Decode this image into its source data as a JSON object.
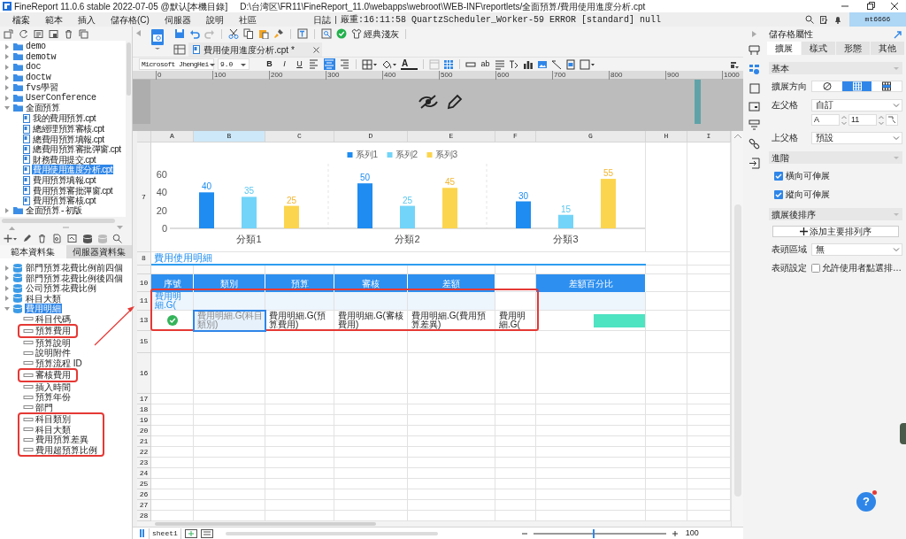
{
  "window": {
    "app_title": "FineReport 11.0.6 stable 2022-07-05 @默认[本機目錄]",
    "path": "D:\\台湾区\\FR11\\FineReport_11.0\\webapps\\webroot\\WEB-INF\\reportlets/全面預算/費用使用進度分析.cpt"
  },
  "menu": [
    "檔案",
    "範本",
    "插入",
    "儲存格(C)",
    "伺服器",
    "說明",
    "社區"
  ],
  "log": {
    "label": "日誌",
    "message": "嚴重:16:11:58 QuartzScheduler_Worker-59 ERROR [standard] null"
  },
  "user": "mt6666",
  "file_tree": [
    {
      "label": "demo",
      "kind": "folder",
      "expanded": false
    },
    {
      "label": "demotw",
      "kind": "folder",
      "expanded": false
    },
    {
      "label": "doc",
      "kind": "folder",
      "expanded": false
    },
    {
      "label": "doctw",
      "kind": "folder",
      "expanded": false
    },
    {
      "label": "fvs學習",
      "kind": "folder",
      "expanded": false
    },
    {
      "label": "UserConference",
      "kind": "folder",
      "expanded": false
    },
    {
      "label": "全面預算",
      "kind": "folder",
      "expanded": true,
      "children": [
        {
          "label": "我的費用預算.cpt",
          "kind": "file",
          "selected": false
        },
        {
          "label": "總經理預算審核.cpt",
          "kind": "file",
          "selected": false
        },
        {
          "label": "總費用預算填報.cpt",
          "kind": "file",
          "selected": false
        },
        {
          "label": "總費用預算審批彈窗.cpt",
          "kind": "file",
          "selected": false
        },
        {
          "label": "財務費用提交.cpt",
          "kind": "file",
          "selected": false
        },
        {
          "label": "費用使用進度分析.cpt",
          "kind": "file",
          "selected": true
        },
        {
          "label": "費用預算填報.cpt",
          "kind": "file",
          "selected": false
        },
        {
          "label": "費用預算審批彈窗.cpt",
          "kind": "file",
          "selected": false
        },
        {
          "label": "費用預算審核.cpt",
          "kind": "file",
          "selected": false
        }
      ]
    },
    {
      "label": "全面預算-初版",
      "kind": "folder",
      "expanded": false
    }
  ],
  "dataset_tabs": [
    {
      "label": "範本資料集",
      "selected": true
    },
    {
      "label": "伺服器資料集",
      "selected": false
    }
  ],
  "datasets": [
    {
      "label": "部門預算花費比例前四個",
      "expanded": false,
      "selected": false
    },
    {
      "label": "部門預算花費比例後四個",
      "expanded": false,
      "selected": false
    },
    {
      "label": "公司預算花費比例",
      "expanded": false,
      "selected": false
    },
    {
      "label": "科目大類",
      "expanded": false,
      "selected": false
    },
    {
      "label": "費用明細",
      "expanded": true,
      "selected": true,
      "children": [
        {
          "label": "科目代碼",
          "highlighted": false
        },
        {
          "label": "預算費用",
          "highlighted": true
        },
        {
          "label": "預算說明",
          "highlighted": false
        },
        {
          "label": "說明附件",
          "highlighted": false
        },
        {
          "label": "預算流程 ID",
          "highlighted": false
        },
        {
          "label": "審核費用",
          "highlighted": true
        },
        {
          "label": "插入時間",
          "highlighted": false
        },
        {
          "label": "預算年份",
          "highlighted": false
        },
        {
          "label": "部門",
          "highlighted": false
        },
        {
          "label": "科目類別",
          "highlighted": true
        },
        {
          "label": "科目大類",
          "highlighted": true
        },
        {
          "label": "費用預算差異",
          "highlighted": true
        },
        {
          "label": "費用超預算比例",
          "highlighted": true
        }
      ]
    }
  ],
  "toolbar": {
    "theme_label": "經典淺灰"
  },
  "template_tab": {
    "label": "費用使用進度分析.cpt *"
  },
  "format": {
    "font": "Microsoft JhengHei",
    "size": "9.0",
    "style_buttons": [
      "B",
      "I",
      "U"
    ],
    "font_color": "A",
    "text_tool": "ab"
  },
  "ruler": [
    "0",
    "100",
    "200",
    "300",
    "400",
    "500",
    "600",
    "700",
    "800",
    "900",
    "1000"
  ],
  "sheet": {
    "columns": [
      {
        "label": "A",
        "selected": false
      },
      {
        "label": "B",
        "selected": true
      },
      {
        "label": "C",
        "selected": false
      },
      {
        "label": "D",
        "selected": false
      },
      {
        "label": "E",
        "selected": false
      },
      {
        "label": "F",
        "selected": false
      },
      {
        "label": "G",
        "selected": false
      },
      {
        "label": "H",
        "selected": false
      },
      {
        "label": "I",
        "selected": false
      }
    ],
    "rows": [
      {
        "number": "7",
        "kind": "chart",
        "chart_data": {
          "type": "bar",
          "categories": [
            "分類1",
            "分類2",
            "分類3"
          ],
          "series": [
            {
              "name": "系列1",
              "color": "#1e8cf0",
              "values": [
                40,
                50,
                30
              ]
            },
            {
              "name": "系列2",
              "color": "#72d4f8",
              "values": [
                35,
                25,
                15
              ]
            },
            {
              "name": "系列3",
              "color": "#fcd54e",
              "values": [
                25,
                45,
                55
              ]
            }
          ],
          "yticks": [
            0,
            20,
            40,
            60
          ],
          "ylim": [
            0,
            60
          ],
          "legend": "top",
          "data_labels": true
        }
      },
      {
        "number": "8",
        "kind": "title",
        "text": "費用使用明細"
      },
      {
        "kind": "spacer"
      },
      {
        "number": "10",
        "kind": "cells",
        "cells": [
          {
            "kind": "header",
            "text": "序號"
          },
          {
            "kind": "header",
            "text": "類別"
          },
          {
            "kind": "header",
            "text": "預算"
          },
          {
            "kind": "header",
            "text": "審核"
          },
          {
            "kind": "header",
            "text": "差額"
          },
          {
            "kind": "blank"
          },
          {
            "kind": "header",
            "text": "差額百分比"
          }
        ]
      },
      {
        "number": "11",
        "kind": "cells",
        "cells": [
          {
            "kind": "formula",
            "text": "費用明細.G("
          },
          {
            "kind": "tint"
          },
          {
            "kind": "tint"
          },
          {
            "kind": "tint"
          },
          {
            "kind": "tint"
          },
          {
            "kind": "blank"
          },
          {
            "kind": "tint"
          }
        ]
      },
      {
        "number": "13",
        "kind": "cells",
        "cells": [
          {
            "kind": "check",
            "selected": false
          },
          {
            "kind": "formula",
            "text": "費用明細.G(科目類別)",
            "selected": true
          },
          {
            "kind": "formula",
            "text": "費用明細.G(預算費用)",
            "selected": false
          },
          {
            "kind": "formula",
            "text": "費用明細.G(審核費用)",
            "selected": false
          },
          {
            "kind": "formula",
            "text": "費用明細.G(費用預算差異)",
            "selected": false
          },
          {
            "kind": "formula",
            "text": "費用明細.G(",
            "selected": false
          },
          {
            "kind": "bar",
            "selected": false
          }
        ]
      },
      {
        "number": "15",
        "kind": "empty"
      },
      {
        "number": "16",
        "kind": "empty"
      },
      {
        "number": "17",
        "kind": "empty"
      },
      {
        "number": "18",
        "kind": "empty"
      },
      {
        "number": "19",
        "kind": "empty"
      },
      {
        "number": "20",
        "kind": "empty"
      },
      {
        "number": "21",
        "kind": "empty"
      },
      {
        "number": "22",
        "kind": "empty"
      },
      {
        "number": "23",
        "kind": "empty"
      },
      {
        "number": "24",
        "kind": "empty"
      },
      {
        "number": "25",
        "kind": "empty"
      },
      {
        "number": "26",
        "kind": "empty"
      },
      {
        "number": "27",
        "kind": "empty"
      },
      {
        "number": "28",
        "kind": "empty"
      }
    ]
  },
  "properties": {
    "title": "儲存格屬性",
    "tabs": [
      {
        "label": "擴展",
        "selected": true
      },
      {
        "label": "樣式",
        "selected": false
      },
      {
        "label": "形態",
        "selected": false
      },
      {
        "label": "其他",
        "selected": false
      }
    ],
    "items": [
      {
        "kind": "section",
        "label": "基本"
      },
      {
        "kind": "direction",
        "label": "擴展方向",
        "options": [
          {
            "selected": false
          },
          {
            "selected": true
          },
          {
            "selected": false
          }
        ]
      },
      {
        "kind": "select",
        "label": "左父格",
        "value": "自訂"
      },
      {
        "kind": "cellref",
        "column": "A",
        "row": "11"
      },
      {
        "kind": "select",
        "label": "上父格",
        "value": "預設"
      },
      {
        "kind": "section",
        "label": "進階"
      },
      {
        "kind": "checkbox",
        "label": "橫向可伸展",
        "checked": true
      },
      {
        "kind": "checkbox",
        "label": "縱向可伸展",
        "checked": true
      },
      {
        "kind": "section",
        "label": "擴展後排序"
      },
      {
        "kind": "button",
        "label": "添加主要排列序"
      },
      {
        "kind": "select",
        "label": "表頭區域",
        "value": "無"
      },
      {
        "kind": "check_row",
        "label": "表頭設定",
        "option": "允許使用者點選排…",
        "checked": false
      }
    ]
  },
  "status_bar": {
    "sheet_tab": "sheet1",
    "zoom": "100",
    "zoom_level": {
      "level": 0.45
    }
  },
  "help_button": "?"
}
